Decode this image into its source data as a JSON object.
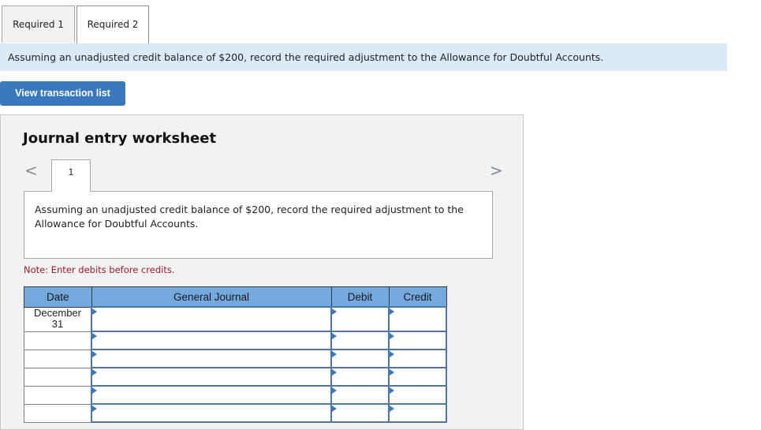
{
  "tabs": [
    {
      "label": "Required 1",
      "active": false
    },
    {
      "label": "Required 2",
      "active": true
    }
  ],
  "instruction": "Assuming an unadjusted credit balance of $200, record the required adjustment to the Allowance for Doubtful Accounts.",
  "view_transactions_button": "View transaction list",
  "worksheet": {
    "title": "Journal entry worksheet",
    "prev_icon": "chevron-left-icon",
    "next_icon": "chevron-right-icon",
    "prev_glyph": "<",
    "next_glyph": ">",
    "current_step": "1",
    "description": "Assuming an unadjusted credit balance of $200, record the required adjustment to the Allowance for Doubtful Accounts.",
    "note": "Note: Enter debits before credits.",
    "table": {
      "headers": [
        "Date",
        "General Journal",
        "Debit",
        "Credit"
      ],
      "rows": [
        {
          "date": "December\n31",
          "account": "",
          "debit": "",
          "credit": ""
        },
        {
          "date": "",
          "account": "",
          "debit": "",
          "credit": ""
        },
        {
          "date": "",
          "account": "",
          "debit": "",
          "credit": ""
        },
        {
          "date": "",
          "account": "",
          "debit": "",
          "credit": ""
        },
        {
          "date": "",
          "account": "",
          "debit": "",
          "credit": ""
        },
        {
          "date": "",
          "account": "",
          "debit": "",
          "credit": ""
        }
      ]
    }
  }
}
